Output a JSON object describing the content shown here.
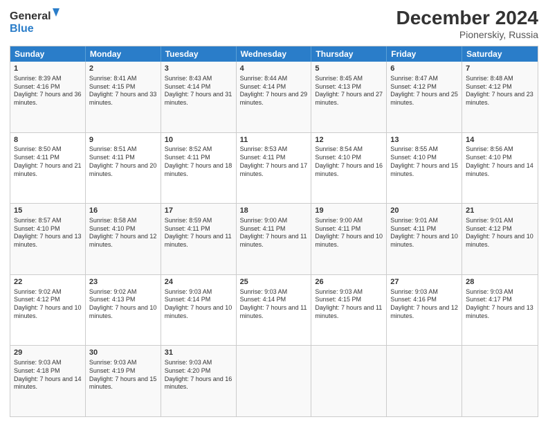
{
  "header": {
    "logo_line1": "General",
    "logo_line2": "Blue",
    "month": "December 2024",
    "location": "Pionerskiy, Russia"
  },
  "days_of_week": [
    "Sunday",
    "Monday",
    "Tuesday",
    "Wednesday",
    "Thursday",
    "Friday",
    "Saturday"
  ],
  "weeks": [
    [
      {
        "day": "1",
        "sunrise": "Sunrise: 8:39 AM",
        "sunset": "Sunset: 4:16 PM",
        "daylight": "Daylight: 7 hours and 36 minutes."
      },
      {
        "day": "2",
        "sunrise": "Sunrise: 8:41 AM",
        "sunset": "Sunset: 4:15 PM",
        "daylight": "Daylight: 7 hours and 33 minutes."
      },
      {
        "day": "3",
        "sunrise": "Sunrise: 8:43 AM",
        "sunset": "Sunset: 4:14 PM",
        "daylight": "Daylight: 7 hours and 31 minutes."
      },
      {
        "day": "4",
        "sunrise": "Sunrise: 8:44 AM",
        "sunset": "Sunset: 4:14 PM",
        "daylight": "Daylight: 7 hours and 29 minutes."
      },
      {
        "day": "5",
        "sunrise": "Sunrise: 8:45 AM",
        "sunset": "Sunset: 4:13 PM",
        "daylight": "Daylight: 7 hours and 27 minutes."
      },
      {
        "day": "6",
        "sunrise": "Sunrise: 8:47 AM",
        "sunset": "Sunset: 4:12 PM",
        "daylight": "Daylight: 7 hours and 25 minutes."
      },
      {
        "day": "7",
        "sunrise": "Sunrise: 8:48 AM",
        "sunset": "Sunset: 4:12 PM",
        "daylight": "Daylight: 7 hours and 23 minutes."
      }
    ],
    [
      {
        "day": "8",
        "sunrise": "Sunrise: 8:50 AM",
        "sunset": "Sunset: 4:11 PM",
        "daylight": "Daylight: 7 hours and 21 minutes."
      },
      {
        "day": "9",
        "sunrise": "Sunrise: 8:51 AM",
        "sunset": "Sunset: 4:11 PM",
        "daylight": "Daylight: 7 hours and 20 minutes."
      },
      {
        "day": "10",
        "sunrise": "Sunrise: 8:52 AM",
        "sunset": "Sunset: 4:11 PM",
        "daylight": "Daylight: 7 hours and 18 minutes."
      },
      {
        "day": "11",
        "sunrise": "Sunrise: 8:53 AM",
        "sunset": "Sunset: 4:11 PM",
        "daylight": "Daylight: 7 hours and 17 minutes."
      },
      {
        "day": "12",
        "sunrise": "Sunrise: 8:54 AM",
        "sunset": "Sunset: 4:10 PM",
        "daylight": "Daylight: 7 hours and 16 minutes."
      },
      {
        "day": "13",
        "sunrise": "Sunrise: 8:55 AM",
        "sunset": "Sunset: 4:10 PM",
        "daylight": "Daylight: 7 hours and 15 minutes."
      },
      {
        "day": "14",
        "sunrise": "Sunrise: 8:56 AM",
        "sunset": "Sunset: 4:10 PM",
        "daylight": "Daylight: 7 hours and 14 minutes."
      }
    ],
    [
      {
        "day": "15",
        "sunrise": "Sunrise: 8:57 AM",
        "sunset": "Sunset: 4:10 PM",
        "daylight": "Daylight: 7 hours and 13 minutes."
      },
      {
        "day": "16",
        "sunrise": "Sunrise: 8:58 AM",
        "sunset": "Sunset: 4:10 PM",
        "daylight": "Daylight: 7 hours and 12 minutes."
      },
      {
        "day": "17",
        "sunrise": "Sunrise: 8:59 AM",
        "sunset": "Sunset: 4:11 PM",
        "daylight": "Daylight: 7 hours and 11 minutes."
      },
      {
        "day": "18",
        "sunrise": "Sunrise: 9:00 AM",
        "sunset": "Sunset: 4:11 PM",
        "daylight": "Daylight: 7 hours and 11 minutes."
      },
      {
        "day": "19",
        "sunrise": "Sunrise: 9:00 AM",
        "sunset": "Sunset: 4:11 PM",
        "daylight": "Daylight: 7 hours and 10 minutes."
      },
      {
        "day": "20",
        "sunrise": "Sunrise: 9:01 AM",
        "sunset": "Sunset: 4:11 PM",
        "daylight": "Daylight: 7 hours and 10 minutes."
      },
      {
        "day": "21",
        "sunrise": "Sunrise: 9:01 AM",
        "sunset": "Sunset: 4:12 PM",
        "daylight": "Daylight: 7 hours and 10 minutes."
      }
    ],
    [
      {
        "day": "22",
        "sunrise": "Sunrise: 9:02 AM",
        "sunset": "Sunset: 4:12 PM",
        "daylight": "Daylight: 7 hours and 10 minutes."
      },
      {
        "day": "23",
        "sunrise": "Sunrise: 9:02 AM",
        "sunset": "Sunset: 4:13 PM",
        "daylight": "Daylight: 7 hours and 10 minutes."
      },
      {
        "day": "24",
        "sunrise": "Sunrise: 9:03 AM",
        "sunset": "Sunset: 4:14 PM",
        "daylight": "Daylight: 7 hours and 10 minutes."
      },
      {
        "day": "25",
        "sunrise": "Sunrise: 9:03 AM",
        "sunset": "Sunset: 4:14 PM",
        "daylight": "Daylight: 7 hours and 11 minutes."
      },
      {
        "day": "26",
        "sunrise": "Sunrise: 9:03 AM",
        "sunset": "Sunset: 4:15 PM",
        "daylight": "Daylight: 7 hours and 11 minutes."
      },
      {
        "day": "27",
        "sunrise": "Sunrise: 9:03 AM",
        "sunset": "Sunset: 4:16 PM",
        "daylight": "Daylight: 7 hours and 12 minutes."
      },
      {
        "day": "28",
        "sunrise": "Sunrise: 9:03 AM",
        "sunset": "Sunset: 4:17 PM",
        "daylight": "Daylight: 7 hours and 13 minutes."
      }
    ],
    [
      {
        "day": "29",
        "sunrise": "Sunrise: 9:03 AM",
        "sunset": "Sunset: 4:18 PM",
        "daylight": "Daylight: 7 hours and 14 minutes."
      },
      {
        "day": "30",
        "sunrise": "Sunrise: 9:03 AM",
        "sunset": "Sunset: 4:19 PM",
        "daylight": "Daylight: 7 hours and 15 minutes."
      },
      {
        "day": "31",
        "sunrise": "Sunrise: 9:03 AM",
        "sunset": "Sunset: 4:20 PM",
        "daylight": "Daylight: 7 hours and 16 minutes."
      },
      null,
      null,
      null,
      null
    ]
  ]
}
